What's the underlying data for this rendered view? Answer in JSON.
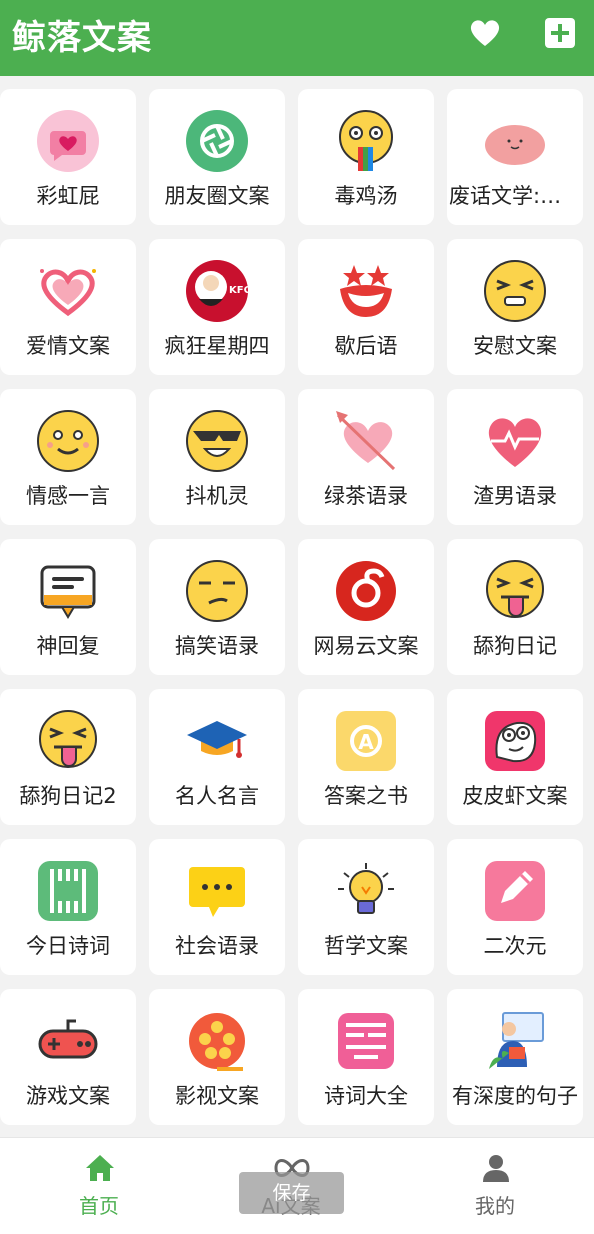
{
  "app": {
    "title": "鲸落文案"
  },
  "header": {
    "favorite_icon": "heart-icon",
    "add_icon": "plus-square-icon"
  },
  "tiles": [
    {
      "label": "彩虹屁",
      "icon": "pink-heart-chat-icon"
    },
    {
      "label": "朋友圈文案",
      "icon": "camera-aperture-icon"
    },
    {
      "label": "毒鸡汤",
      "icon": "rainbow-tongue-face-icon"
    },
    {
      "label": "废话文学:胡…",
      "icon": "pink-blob-face-icon"
    },
    {
      "label": "爱情文案",
      "icon": "sparkle-heart-icon"
    },
    {
      "label": "疯狂星期四",
      "icon": "kfc-logo-icon"
    },
    {
      "label": "歇后语",
      "icon": "clown-mouth-icon"
    },
    {
      "label": "安慰文案",
      "icon": "squint-face-icon"
    },
    {
      "label": "情感一言",
      "icon": "smiling-face-icon"
    },
    {
      "label": "抖机灵",
      "icon": "sunglasses-face-icon"
    },
    {
      "label": "绿茶语录",
      "icon": "arrow-heart-icon"
    },
    {
      "label": "渣男语录",
      "icon": "heartbeat-heart-icon"
    },
    {
      "label": "神回复",
      "icon": "message-box-icon"
    },
    {
      "label": "搞笑语录",
      "icon": "smirk-face-icon"
    },
    {
      "label": "网易云文案",
      "icon": "netease-music-icon"
    },
    {
      "label": "舔狗日记",
      "icon": "tongue-wink-face-icon"
    },
    {
      "label": "舔狗日记2",
      "icon": "tongue-wink-face-icon"
    },
    {
      "label": "名人名言",
      "icon": "graduation-cap-icon"
    },
    {
      "label": "答案之书",
      "icon": "answer-book-icon"
    },
    {
      "label": "皮皮虾文案",
      "icon": "silly-face-app-icon"
    },
    {
      "label": "今日诗词",
      "icon": "poem-scroll-icon"
    },
    {
      "label": "社会语录",
      "icon": "chat-bubble-dots-icon"
    },
    {
      "label": "哲学文案",
      "icon": "lightbulb-icon"
    },
    {
      "label": "二次元",
      "icon": "pencil-app-icon"
    },
    {
      "label": "游戏文案",
      "icon": "gamepad-icon"
    },
    {
      "label": "影视文案",
      "icon": "film-reel-icon"
    },
    {
      "label": "诗词大全",
      "icon": "poetry-collection-icon"
    },
    {
      "label": "有深度的句子",
      "icon": "reading-person-icon"
    }
  ],
  "bottom_nav": [
    {
      "label": "首页",
      "icon": "home-icon",
      "active": true
    },
    {
      "label": "Ai文案",
      "icon": "infinity-icon",
      "active": false
    },
    {
      "label": "我的",
      "icon": "person-icon",
      "active": false
    }
  ],
  "toast": {
    "text": "保存"
  },
  "colors": {
    "accent": "#4caf50",
    "background": "#f2f2f2"
  }
}
